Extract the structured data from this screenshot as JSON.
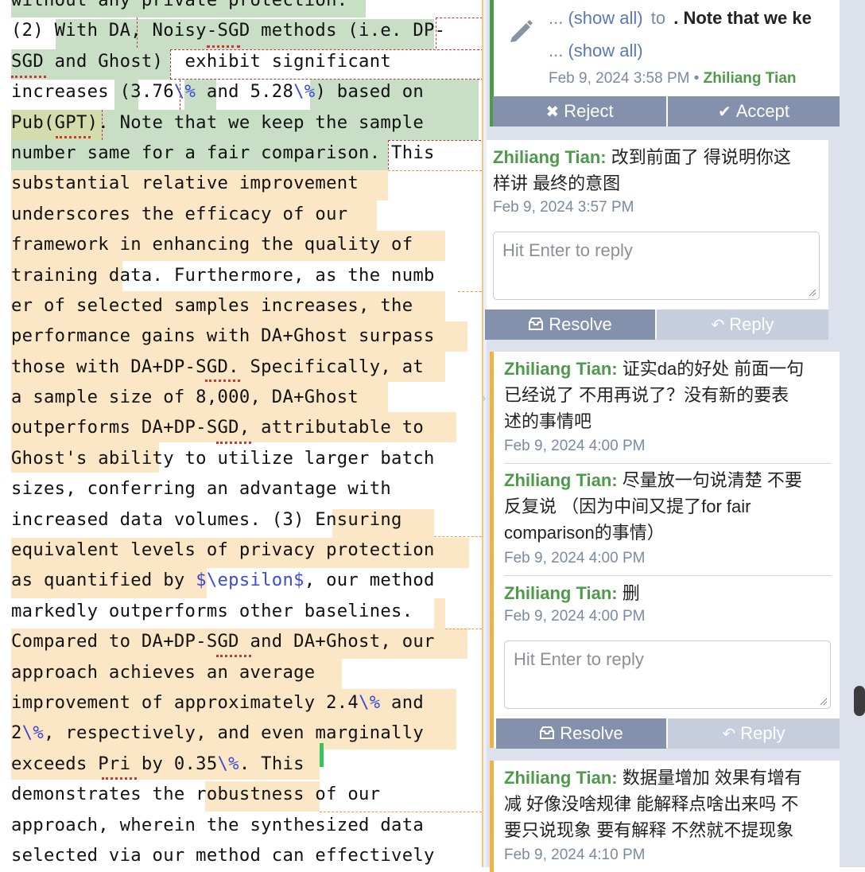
{
  "editor": {
    "lines": [
      "without any private protection.",
      "(2) With DA, Noisy-SGD methods (i.e. DP-",
      "SGD and Ghost)  exhibit significant",
      "increases (3.76\\% and 5.28\\%) based on",
      "Pub(GPT). Note that we keep the sample",
      "number same for a fair comparison. This",
      "substantial relative improvement",
      "underscores the efficacy of our",
      "framework in enhancing the quality of",
      "training data. Furthermore, as the numb",
      "er of selected samples increases, the",
      "performance gains with DA+Ghost surpass",
      "those with DA+DP-SGD. Specifically, at",
      "a sample size of 8,000, DA+Ghost",
      "outperforms DA+DP-SGD, attributable to",
      "Ghost's ability to utilize larger batch",
      "sizes, conferring an advantage with",
      "increased data volumes. (3) Ensuring",
      "equivalent levels of privacy protection",
      "as quantified by $\\epsilon$, our method",
      "markedly outperforms other baselines.",
      "Compared to DA+DP-SGD and DA+Ghost, our",
      "approach achieves an average",
      "improvement of approximately 2.4\\% and",
      "2\\%, respectively, and even marginally",
      "exceeds Pri by 0.35\\%. This",
      "demonstrates the robustness of our",
      "approach, wherein the synthesized data",
      "selected via our method can effectively"
    ],
    "colors": {
      "highlight": "#fbe6c5",
      "accepted": "#c8dfc6",
      "macro": "#3b4bd6"
    }
  },
  "card1": {
    "icon": "pencil-icon",
    "line1_prefix": "...",
    "line1_link": "(show all)",
    "line1_to": "to",
    "line1_text": ". Note that we ke",
    "line2_prefix": "...",
    "line2_link": "(show all)",
    "date": "Feb 9, 2024 3:58 PM",
    "bullet": "•",
    "author": "Zhiliang Tian",
    "reject_label": "Reject",
    "accept_label": "Accept"
  },
  "card2": {
    "author": "Zhiliang Tian:",
    "text_l1": "改到前面了 得说明你这",
    "text_l2": "样讲  最终的意图",
    "date": "Feb 9, 2024 3:57 PM",
    "reply_placeholder": "Hit Enter to reply",
    "resolve_label": "Resolve",
    "reply_label": "Reply"
  },
  "card3": {
    "comments": [
      {
        "author": "Zhiliang Tian:",
        "l1": "证实da的好处 前面一句",
        "l2": "已经说了 不用再说了？没有新的要表",
        "l3": "述的事情吧",
        "date": "Feb 9, 2024 4:00 PM"
      },
      {
        "author": "Zhiliang Tian:",
        "l1": "尽量放一句说清楚 不要",
        "l2": "反复说 （因为中间又提了for fair",
        "l3": "comparison的事情）",
        "date": "Feb 9, 2024 4:00 PM"
      },
      {
        "author": "Zhiliang Tian:",
        "l1": "删",
        "date": "Feb 9, 2024 4:00 PM"
      }
    ],
    "reply_placeholder": "Hit Enter to reply",
    "resolve_label": "Resolve",
    "reply_label": "Reply"
  },
  "card4": {
    "author": "Zhiliang Tian:",
    "l1": "数据量增加 效果有增有",
    "l2": "减 好像没啥规律 能解释点啥出来吗 不",
    "l3": "要只说现象 要有解释 不然就不提现象",
    "date": "Feb 9, 2024 4:10 PM"
  }
}
